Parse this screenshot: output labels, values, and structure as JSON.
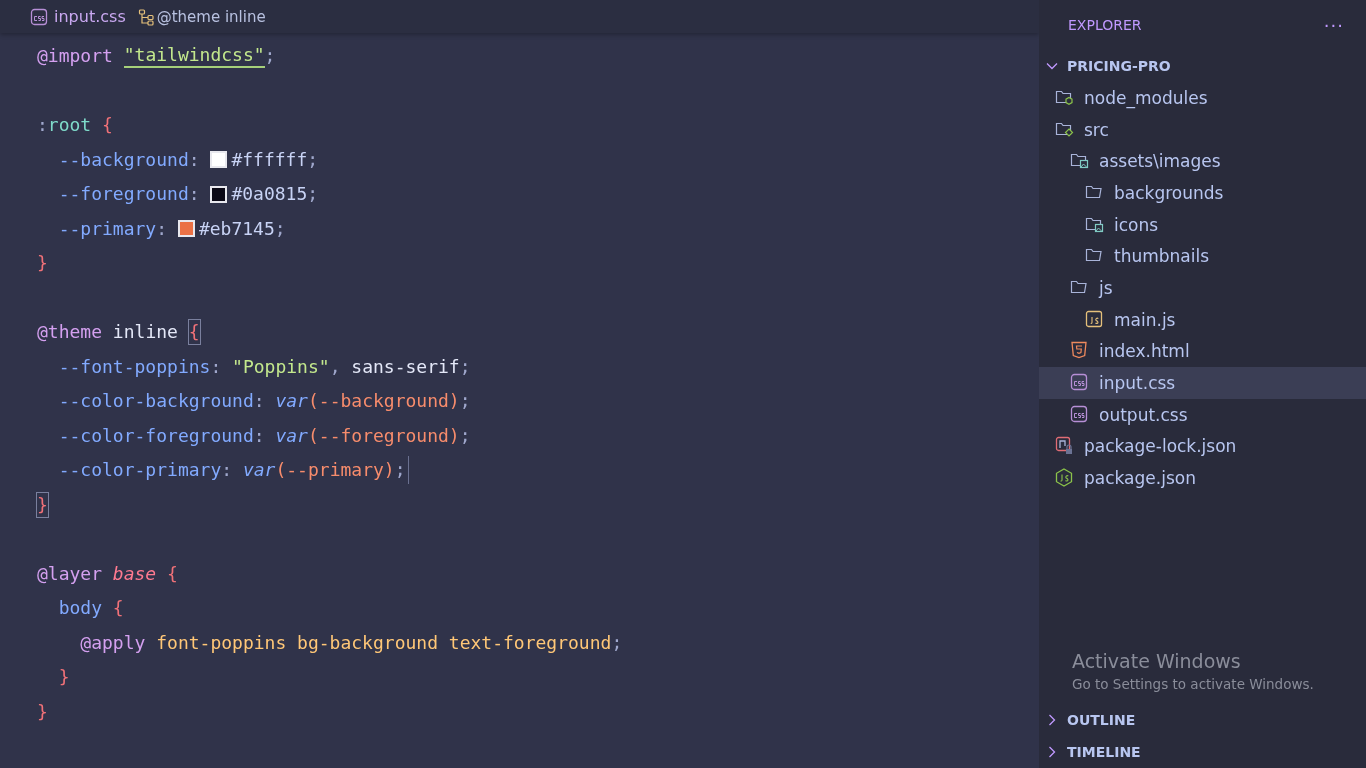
{
  "breadcrumb": {
    "file": "input.css",
    "symbol": "@theme inline"
  },
  "code_lines": [
    {
      "kind": "code",
      "tokens": [
        {
          "t": "@import ",
          "kind": "atrule"
        },
        {
          "t": "\"tailwindcss\"",
          "kind": "link"
        },
        {
          "t": ";",
          "kind": "punct"
        }
      ]
    },
    {
      "kind": "blank"
    },
    {
      "kind": "code",
      "tokens": [
        {
          "t": ":",
          "kind": "punct"
        },
        {
          "t": "root ",
          "kind": "selector"
        },
        {
          "t": "{",
          "kind": "brace"
        }
      ]
    },
    {
      "kind": "code",
      "tokens": [
        {
          "t": "  --background",
          "kind": "prop"
        },
        {
          "t": ": ",
          "kind": "punct"
        },
        {
          "kind": "swatch",
          "color": "#ffffff"
        },
        {
          "t": "#ffffff",
          "kind": "value"
        },
        {
          "t": ";",
          "kind": "punct"
        }
      ]
    },
    {
      "kind": "code",
      "tokens": [
        {
          "t": "  --foreground",
          "kind": "prop"
        },
        {
          "t": ": ",
          "kind": "punct"
        },
        {
          "kind": "swatch",
          "color": "#0a0815"
        },
        {
          "t": "#0a0815",
          "kind": "value"
        },
        {
          "t": ";",
          "kind": "punct"
        }
      ]
    },
    {
      "kind": "code",
      "tokens": [
        {
          "t": "  --primary",
          "kind": "prop"
        },
        {
          "t": ": ",
          "kind": "punct"
        },
        {
          "kind": "swatch",
          "color": "#eb7145"
        },
        {
          "t": "#eb7145",
          "kind": "value"
        },
        {
          "t": ";",
          "kind": "punct"
        }
      ]
    },
    {
      "kind": "code",
      "tokens": [
        {
          "t": "}",
          "kind": "brace"
        }
      ]
    },
    {
      "kind": "blank"
    },
    {
      "kind": "code",
      "tokens": [
        {
          "t": "@theme",
          "kind": "atrule"
        },
        {
          "t": " inline ",
          "kind": "plain"
        },
        {
          "t": "{",
          "kind": "match"
        }
      ]
    },
    {
      "kind": "code",
      "tokens": [
        {
          "t": "  --font-poppins",
          "kind": "prop"
        },
        {
          "t": ": ",
          "kind": "punct"
        },
        {
          "t": "\"Poppins\"",
          "kind": "string"
        },
        {
          "t": ", ",
          "kind": "punct"
        },
        {
          "t": "sans-serif",
          "kind": "plain"
        },
        {
          "t": ";",
          "kind": "punct"
        }
      ]
    },
    {
      "kind": "code",
      "tokens": [
        {
          "t": "  --color-background",
          "kind": "prop"
        },
        {
          "t": ": ",
          "kind": "punct"
        },
        {
          "t": "var",
          "kind": "func"
        },
        {
          "t": "(",
          "kind": "paren"
        },
        {
          "t": "--background",
          "kind": "arg"
        },
        {
          "t": ")",
          "kind": "paren"
        },
        {
          "t": ";",
          "kind": "punct"
        }
      ]
    },
    {
      "kind": "code",
      "tokens": [
        {
          "t": "  --color-foreground",
          "kind": "prop"
        },
        {
          "t": ": ",
          "kind": "punct"
        },
        {
          "t": "var",
          "kind": "func"
        },
        {
          "t": "(",
          "kind": "paren"
        },
        {
          "t": "--foreground",
          "kind": "arg"
        },
        {
          "t": ")",
          "kind": "paren"
        },
        {
          "t": ";",
          "kind": "punct"
        }
      ]
    },
    {
      "kind": "code",
      "tokens": [
        {
          "t": "  --color-primary",
          "kind": "prop"
        },
        {
          "t": ": ",
          "kind": "punct"
        },
        {
          "t": "var",
          "kind": "func"
        },
        {
          "t": "(",
          "kind": "paren"
        },
        {
          "t": "--primary",
          "kind": "arg"
        },
        {
          "t": ")",
          "kind": "paren"
        },
        {
          "t": ";",
          "kind": "punct"
        },
        {
          "kind": "cursor"
        }
      ]
    },
    {
      "kind": "code",
      "tokens": [
        {
          "t": "}",
          "kind": "match"
        }
      ]
    },
    {
      "kind": "blank"
    },
    {
      "kind": "code",
      "tokens": [
        {
          "t": "@layer ",
          "kind": "atrule"
        },
        {
          "t": "base ",
          "kind": "layer"
        },
        {
          "t": "{",
          "kind": "brace"
        }
      ]
    },
    {
      "kind": "code",
      "tokens": [
        {
          "t": "  body ",
          "kind": "tag"
        },
        {
          "t": "{",
          "kind": "brace"
        }
      ]
    },
    {
      "kind": "code",
      "tokens": [
        {
          "t": "    @apply ",
          "kind": "atrule"
        },
        {
          "t": "font-poppins bg-background text-foreground",
          "kind": "cls"
        },
        {
          "t": ";",
          "kind": "punct"
        }
      ]
    },
    {
      "kind": "code",
      "tokens": [
        {
          "t": "  }",
          "kind": "brace"
        }
      ]
    },
    {
      "kind": "code",
      "tokens": [
        {
          "t": "}",
          "kind": "brace"
        }
      ]
    }
  ],
  "explorer": {
    "title": "EXPLORER",
    "more": "···",
    "project": {
      "label": "PRICING-PRO",
      "expanded": true,
      "children": [
        {
          "label": "node_modules",
          "kind": "nodefolder",
          "selected": false
        },
        {
          "label": "src",
          "kind": "srcfolder",
          "selected": false,
          "children": [
            {
              "label": "assets\\images",
              "kind": "imagefolder",
              "selected": false,
              "children": [
                {
                  "label": "backgrounds",
                  "kind": "folder",
                  "selected": false
                },
                {
                  "label": "icons",
                  "kind": "imagefolder",
                  "selected": false
                },
                {
                  "label": "thumbnails",
                  "kind": "folder",
                  "selected": false
                }
              ]
            },
            {
              "label": "js",
              "kind": "folder",
              "selected": false,
              "children": [
                {
                  "label": "main.js",
                  "kind": "jsfile",
                  "selected": false
                }
              ]
            },
            {
              "label": "index.html",
              "kind": "htmlfile",
              "selected": false
            },
            {
              "label": "input.css",
              "kind": "cssfile",
              "selected": true
            },
            {
              "label": "output.css",
              "kind": "cssfile",
              "selected": false
            }
          ]
        },
        {
          "label": "package-lock.json",
          "kind": "lockfile",
          "selected": false
        },
        {
          "label": "package.json",
          "kind": "nodefile",
          "selected": false
        }
      ]
    },
    "sections": [
      {
        "label": "OUTLINE",
        "expanded": false
      },
      {
        "label": "TIMELINE",
        "expanded": false
      }
    ]
  },
  "activation_notice": {
    "title": "Activate Windows",
    "text": "Go to Settings to activate Windows."
  }
}
